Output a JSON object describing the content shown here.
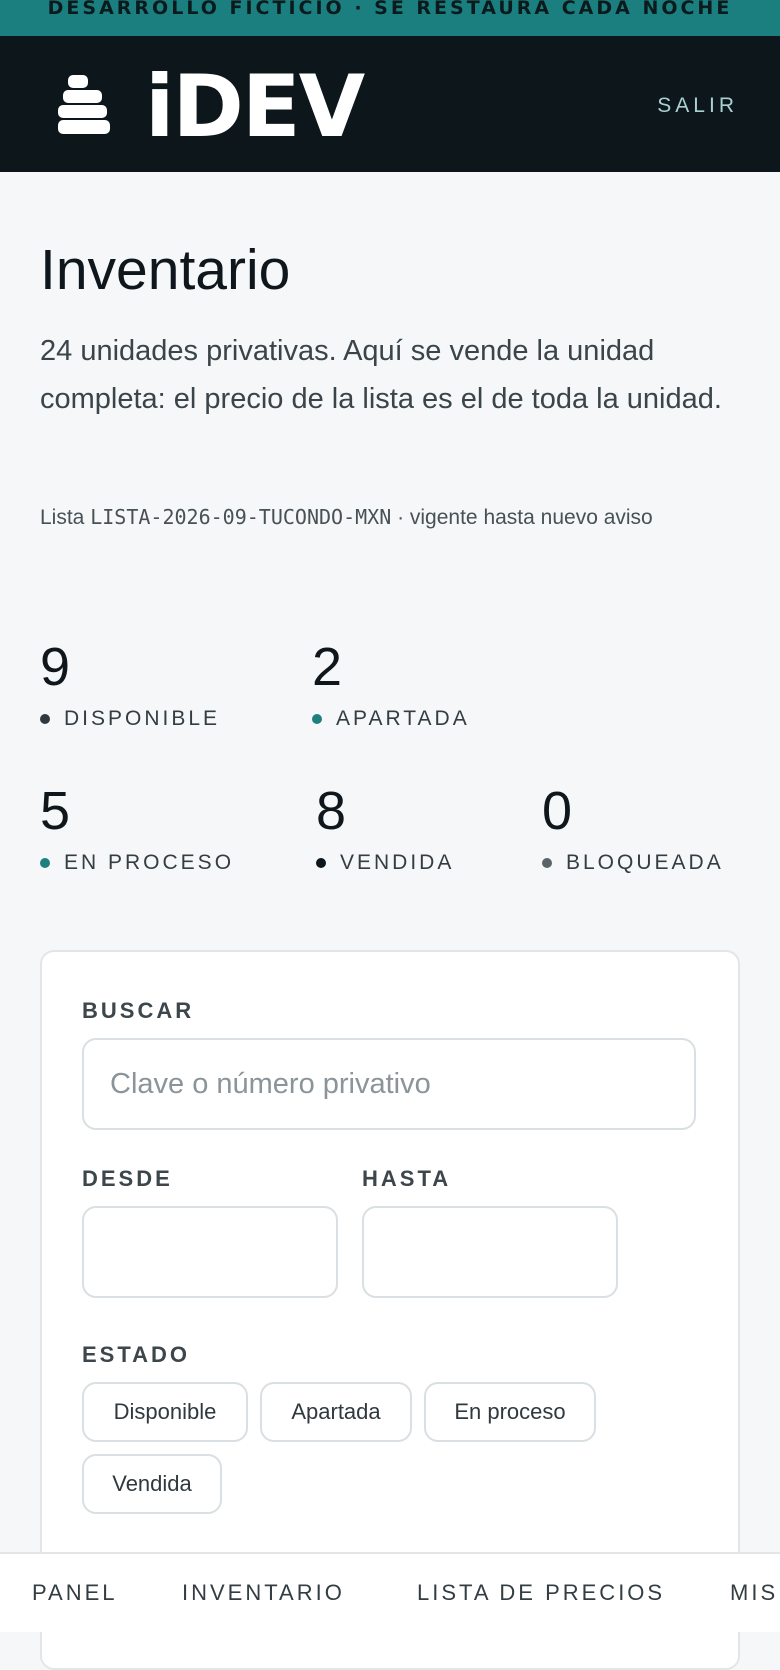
{
  "banner": {
    "text": "DESARROLLO FICTICIO · SE RESTAURA CADA NOCHE"
  },
  "header": {
    "logo_icon": "stacked-bars-logo-icon",
    "logo_text": "iDEV",
    "logout_label": "SALIR"
  },
  "page": {
    "title": "Inventario",
    "subtitle": "24 unidades privativas. Aquí se vende la unidad completa: el precio de la lista es el de toda la unidad.",
    "list_prefix": "Lista ",
    "list_code": "LISTA-2026-09-TUCONDO-MXN",
    "list_suffix": " · vigente hasta nuevo aviso"
  },
  "stats": [
    {
      "value": "9",
      "label": "DISPONIBLE",
      "color": "#2f3a40"
    },
    {
      "value": "2",
      "label": "APARTADA",
      "color": "#1f7f80"
    },
    {
      "value": "5",
      "label": "EN PROCESO",
      "color": "#1f7f80"
    },
    {
      "value": "8",
      "label": "VENDIDA",
      "color": "#0d161b"
    },
    {
      "value": "0",
      "label": "BLOQUEADA",
      "color": "#6d767a"
    }
  ],
  "filters": {
    "search_label": "BUSCAR",
    "search_placeholder": "Clave o número privativo",
    "from_label": "DESDE",
    "from_value": "",
    "to_label": "HASTA",
    "to_value": "",
    "status_label": "ESTADO",
    "status_options": [
      "Disponible",
      "Apartada",
      "En proceso",
      "Vendida"
    ]
  },
  "nav": {
    "items": [
      "PANEL",
      "INVENTARIO",
      "LISTA DE PRECIOS",
      "MIS"
    ]
  },
  "colors": {
    "accent": "#1b7f80",
    "header_bg": "#0d161b",
    "page_bg": "#f5f7f8"
  }
}
